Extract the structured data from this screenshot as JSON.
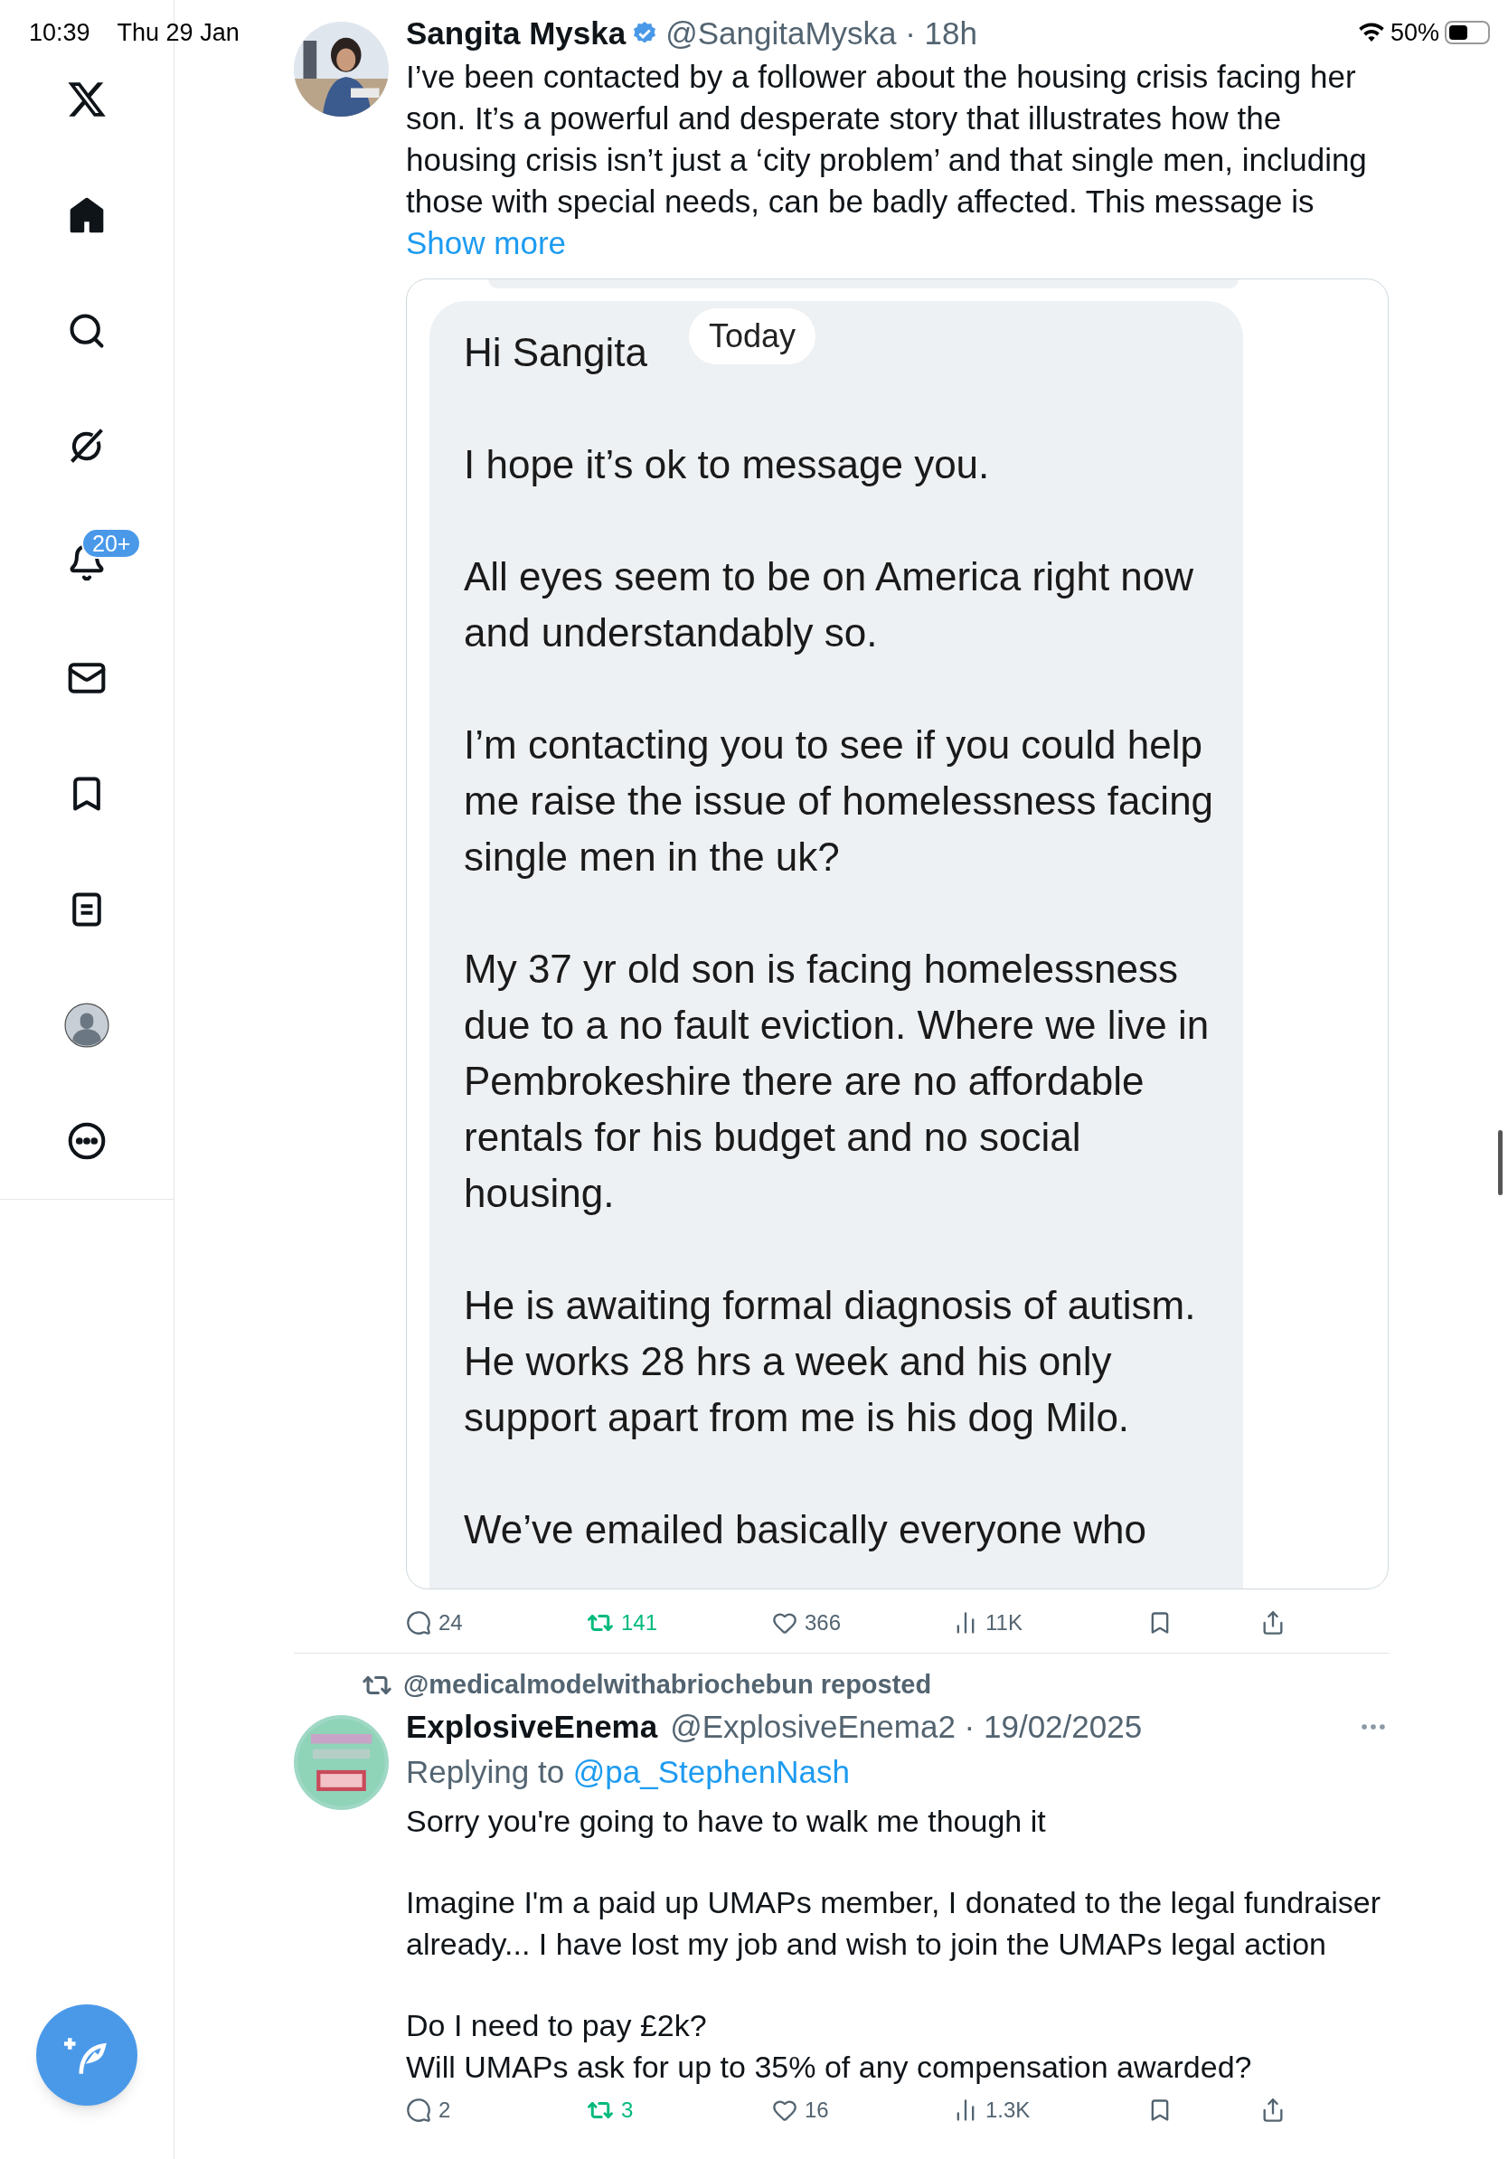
{
  "status_bar": {
    "time": "10:39",
    "date": "Thu 29 Jan",
    "battery": "50%"
  },
  "sidebar": {
    "items": [
      {
        "kind": "logo",
        "selected": false
      },
      {
        "kind": "home",
        "selected": true
      },
      {
        "kind": "search",
        "selected": false
      },
      {
        "kind": "grok",
        "selected": false
      },
      {
        "kind": "notifications",
        "selected": false,
        "badge": "20+"
      },
      {
        "kind": "messages",
        "selected": false
      },
      {
        "kind": "bookmarks",
        "selected": false
      },
      {
        "kind": "lists",
        "selected": false
      },
      {
        "kind": "profile",
        "selected": false
      },
      {
        "kind": "more",
        "selected": false
      }
    ]
  },
  "posts": [
    {
      "name": "Sangita Myska",
      "verified": true,
      "handle_time": "@SangitaMyska · 18h",
      "menu": false,
      "body": [
        "I’ve been contacted by a follower about the housing crisis facing her son. It’s a  powerful and desperate story that illustrates how the housing crisis isn’t just a ‘city problem’ and that single men, including those with special needs, can be badly affected. This message is"
      ],
      "show_more": "Show more",
      "quote": {
        "kind": "message_screenshot",
        "date_pill": "Today",
        "paragraphs": [
          "Hi Sangita",
          "I hope it’s ok to message you.",
          "All eyes seem to be on America right now and understandably so.",
          "I’m contacting you to see if you could help me raise the issue of homelessness facing single men in the uk?",
          "My 37 yr old son is facing homelessness due to a no fault eviction.  Where we live in Pembrokeshire there are no affordable rentals for his budget and no social housing.",
          "He is awaiting formal diagnosis of autism. He works 28 hrs a week and his only support apart from me is his dog Milo.",
          "We’ve emailed basically everyone who"
        ]
      },
      "actions": {
        "replies": "24",
        "reposts": "141",
        "reposted": true,
        "likes": "366",
        "views": "11K"
      }
    },
    {
      "reposted_by": "@medicalmodelwithabriochebun reposted",
      "name": "ExplosiveEnema",
      "verified": false,
      "handle_time": "@ExplosiveEnema2 · 19/02/2025",
      "menu": true,
      "replying_to_label": "Replying to",
      "replying_to": "@pa_StephenNash",
      "body": [
        "Sorry you're going to have to walk me though it",
        "Imagine I'm a paid up UMAPs member, I donated to the legal fundraiser already... I have lost my job and wish to join the UMAPs legal action",
        "Do I need to pay £2k?\nWill UMAPs ask for up to 35% of any compensation awarded?"
      ],
      "actions": {
        "replies": "2",
        "reposts": "3",
        "reposted": true,
        "likes": "16",
        "views": "1.3K"
      }
    }
  ]
}
